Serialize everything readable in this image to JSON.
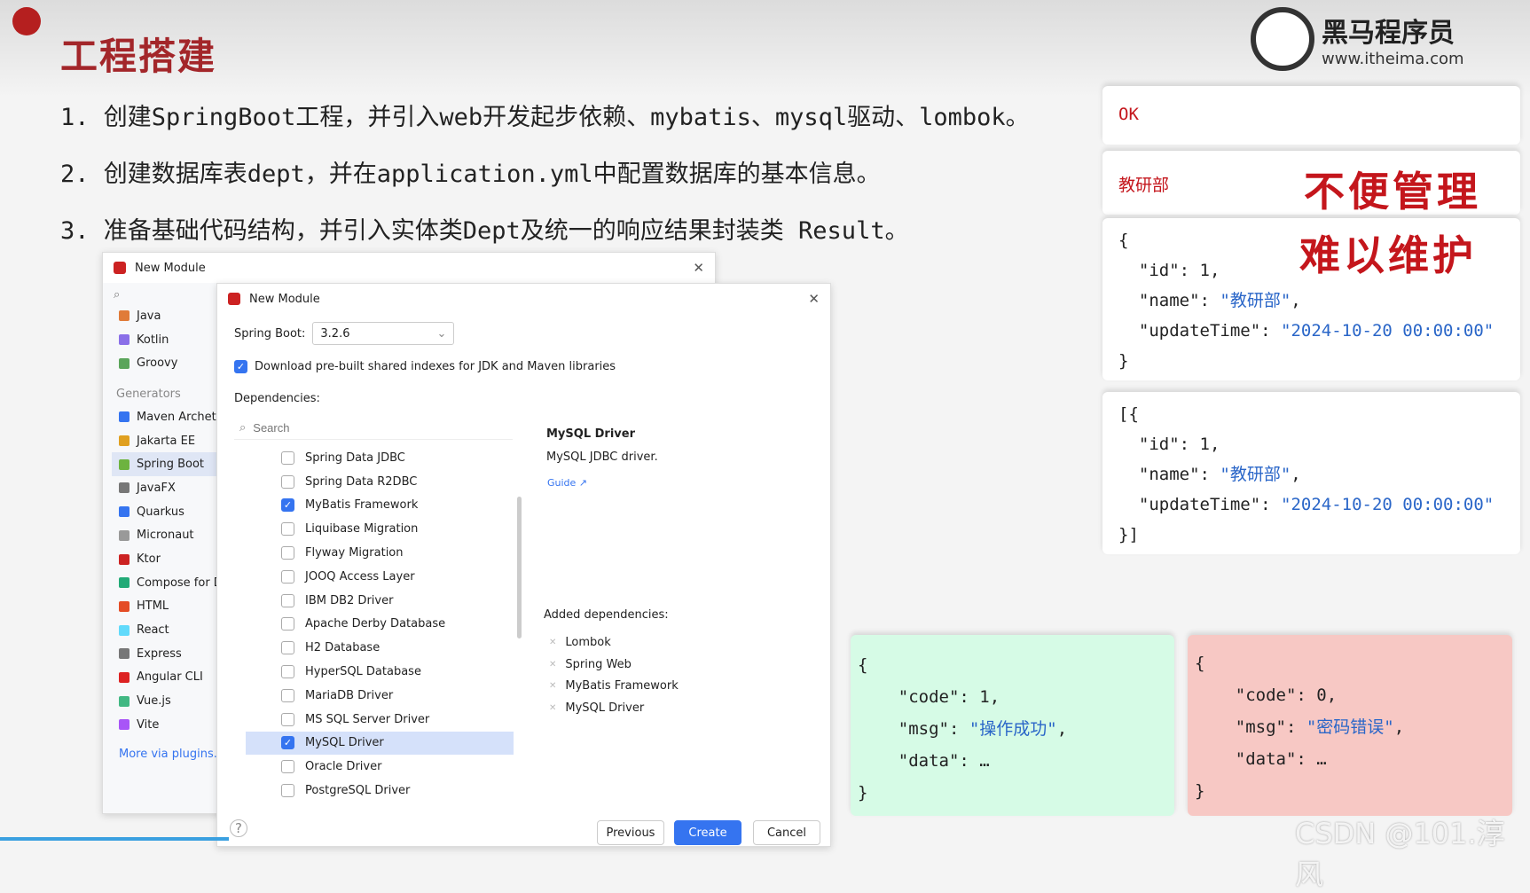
{
  "slide": {
    "title": "工程搭建",
    "steps": [
      "1. 创建SpringBoot工程，并引入web开发起步依赖、mybatis、mysql驱动、lombok。",
      "2. 创建数据库表dept，并在application.yml中配置数据库的基本信息。",
      "3. 准备基础代码结构，并引入实体类Dept及统一的响应结果封装类 Result。"
    ]
  },
  "logo": {
    "name": "黑马程序员",
    "url": "www.itheima.com"
  },
  "back_dialog": {
    "title": "New Module",
    "items": [
      "Java",
      "Kotlin",
      "Groovy"
    ],
    "generators_label": "Generators",
    "generators": [
      "Maven Archetype",
      "Jakarta EE",
      "Spring Boot",
      "JavaFX",
      "Quarkus",
      "Micronaut",
      "Ktor",
      "Compose for Desktop",
      "HTML",
      "React",
      "Express",
      "Angular CLI",
      "Vue.js",
      "Vite"
    ],
    "selected": "Spring Boot",
    "more": "More via plugins..."
  },
  "front_dialog": {
    "title": "New Module",
    "spring_boot_label": "Spring Boot:",
    "spring_boot_version": "3.2.6",
    "download_label": "Download pre-built shared indexes for JDK and Maven libraries",
    "dependencies_label": "Dependencies:",
    "search_placeholder": "Search",
    "dependencies": [
      {
        "name": "Spring Data JDBC",
        "checked": false
      },
      {
        "name": "Spring Data R2DBC",
        "checked": false
      },
      {
        "name": "MyBatis Framework",
        "checked": true
      },
      {
        "name": "Liquibase Migration",
        "checked": false
      },
      {
        "name": "Flyway Migration",
        "checked": false
      },
      {
        "name": "JOOQ Access Layer",
        "checked": false
      },
      {
        "name": "IBM DB2 Driver",
        "checked": false
      },
      {
        "name": "Apache Derby Database",
        "checked": false
      },
      {
        "name": "H2 Database",
        "checked": false
      },
      {
        "name": "HyperSQL Database",
        "checked": false
      },
      {
        "name": "MariaDB Driver",
        "checked": false
      },
      {
        "name": "MS SQL Server Driver",
        "checked": false
      },
      {
        "name": "MySQL Driver",
        "checked": true
      },
      {
        "name": "Oracle Driver",
        "checked": false
      },
      {
        "name": "PostgreSQL Driver",
        "checked": false
      }
    ],
    "detail_title": "MySQL Driver",
    "detail_desc": "MySQL JDBC driver.",
    "guide": "Guide ↗",
    "added_label": "Added dependencies:",
    "added": [
      "Lombok",
      "Spring Web",
      "MyBatis Framework",
      "MySQL Driver"
    ],
    "buttons": {
      "previous": "Previous",
      "create": "Create",
      "cancel": "Cancel"
    }
  },
  "right": {
    "ok": "OK",
    "plain": "教研部",
    "stamp1": "不便管理",
    "stamp2": "难以维护",
    "obj": [
      "{",
      "  \"id\": 1,",
      "  \"name\": \"教研部\",",
      "  \"updateTime\": \"2024-10-20 00:00:00\"",
      "}"
    ],
    "arr": [
      "[{",
      "  \"id\": 1,",
      "  \"name\": \"教研部\",",
      "  \"updateTime\": \"2024-10-20 00:00:00\"",
      "}]"
    ],
    "success": [
      "{",
      "    \"code\": 1,",
      "    \"msg\": \"操作成功\",",
      "    \"data\": …",
      "}"
    ],
    "fail": [
      "{",
      "    \"code\": 0,",
      "    \"msg\": \"密码错误\",",
      "    \"data\": …",
      "}"
    ],
    "colors": {
      "success_bg": "#d6fbe6",
      "fail_bg": "#f7c8c4"
    }
  },
  "watermark": "CSDN @101.淳风"
}
